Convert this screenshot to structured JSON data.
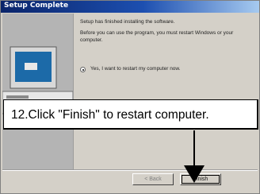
{
  "window": {
    "title": "Setup Complete"
  },
  "content": {
    "heading": "Setup has finished installing the software.",
    "body": "Before you can use the program, you must restart Windows or your computer.",
    "radio_label": "Yes, I want to restart my computer now."
  },
  "buttons": {
    "back_label": "< Back",
    "finish_label": "Finish"
  },
  "callout": {
    "text": "12.Click \"Finish\" to restart computer."
  }
}
